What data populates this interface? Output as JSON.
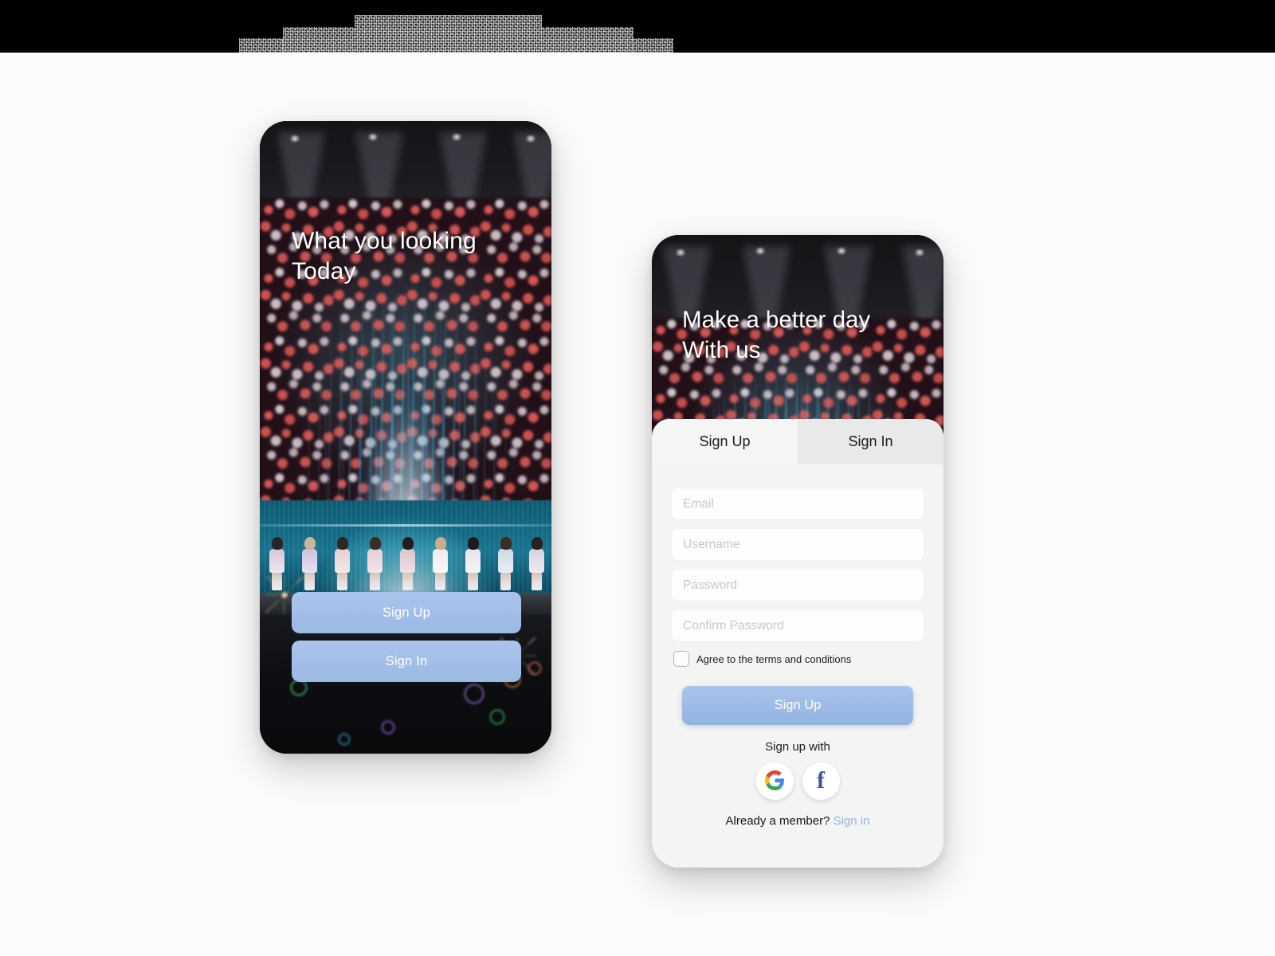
{
  "page": {
    "background_color": "#fbfbfb",
    "topbar_color": "#000000"
  },
  "theme": {
    "accent": "#9cb9e4",
    "accent_dark": "#93b3e2",
    "sheet_bg": "#f4f4f4",
    "tab_active_bg": "#f5f5f5",
    "tab_inactive_bg": "#e9e9e9",
    "field_bg": "#fdfdfd",
    "placeholder_color": "#c8c8c8",
    "link_color": "#93b3e2",
    "google_blue": "#4285F4",
    "google_red": "#EA4335",
    "google_yellow": "#FBBC05",
    "google_green": "#34A853",
    "facebook_blue": "#3b5998"
  },
  "screen_one": {
    "name": "onboarding-screen",
    "hero_title": "What you looking\nToday",
    "buttons": [
      {
        "label": "Sign Up",
        "name": "sign-up-button"
      },
      {
        "label": "Sign In",
        "name": "sign-in-button"
      }
    ]
  },
  "screen_two": {
    "name": "sign-up-screen",
    "hero_title": "Make a better day\nWith us",
    "tabs": [
      {
        "label": "Sign Up",
        "active": true
      },
      {
        "label": "Sign In",
        "active": false
      }
    ],
    "fields": [
      {
        "name": "email-field",
        "placeholder": "Email",
        "value": "",
        "type": "text"
      },
      {
        "name": "username-field",
        "placeholder": "Username",
        "value": "",
        "type": "text"
      },
      {
        "name": "password-field",
        "placeholder": "Password",
        "value": "",
        "type": "password"
      },
      {
        "name": "confirm-password-field",
        "placeholder": "Confirm Password",
        "value": "",
        "type": "password"
      }
    ],
    "terms": {
      "label": "Agree to the terms and conditions",
      "checked": false
    },
    "submit_label": "Sign Up",
    "social_prompt": "Sign up with",
    "social_buttons": [
      {
        "name": "google-icon",
        "glyph": "G"
      },
      {
        "name": "facebook-icon",
        "glyph": "f"
      }
    ],
    "footer": {
      "text": "Already a member?",
      "link": "Sign in"
    }
  }
}
